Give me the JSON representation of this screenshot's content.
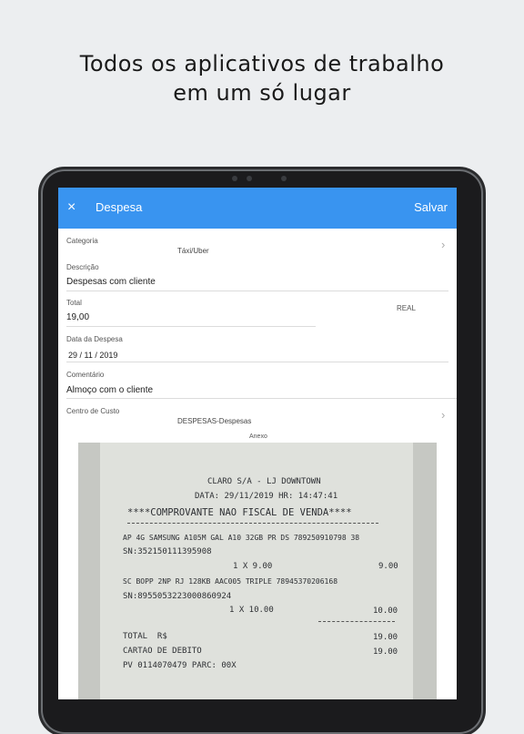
{
  "headline": {
    "line1": "Todos os aplicativos de trabalho",
    "line2": "em um só lugar"
  },
  "appbar": {
    "close_icon": "×",
    "title": "Despesa",
    "save_label": "Salvar"
  },
  "form": {
    "categoria": {
      "label": "Categoria",
      "value": "Táxi/Uber"
    },
    "descricao": {
      "label": "Descrição",
      "value": "Despesas com cliente"
    },
    "total": {
      "label": "Total",
      "value": "19,00",
      "currency": "REAL"
    },
    "data": {
      "label": "Data da Despesa",
      "value": "29 / 11 / 2019"
    },
    "comentario": {
      "label": "Comentário",
      "value": "Almoço com o cliente"
    },
    "centro_custo": {
      "label": "Centro de Custo",
      "value": "DESPESAS-Despesas"
    },
    "anexo_label": "Anexo"
  },
  "receipt": {
    "store": "CLARO S/A - LJ DOWNTOWN",
    "date": "DATA: 29/11/2019 HR: 14:47:41",
    "heading": "****COMPROVANTE NAO FISCAL DE VENDA****",
    "item1": "AP 4G SAMSUNG A105M GAL A10 32GB PR DS 789250910798 38",
    "item1_sn": "SN:352150111395908",
    "item1_qty": "1 X 9.00",
    "item1_price": "9.00",
    "item2": "SC BOPP 2NP RJ 128KB AAC005 TRIPLE 78945370206168",
    "item2_sn": "SN:8955053223000860924",
    "item2_qty": "1 X 10.00",
    "item2_price": "10.00",
    "total_label": "TOTAL  R$",
    "total_value": "19.00",
    "card_label": "CARTAO DE DEBITO",
    "card_value": "19.00",
    "pv": "PV 0114070479 PARC: 00X"
  }
}
